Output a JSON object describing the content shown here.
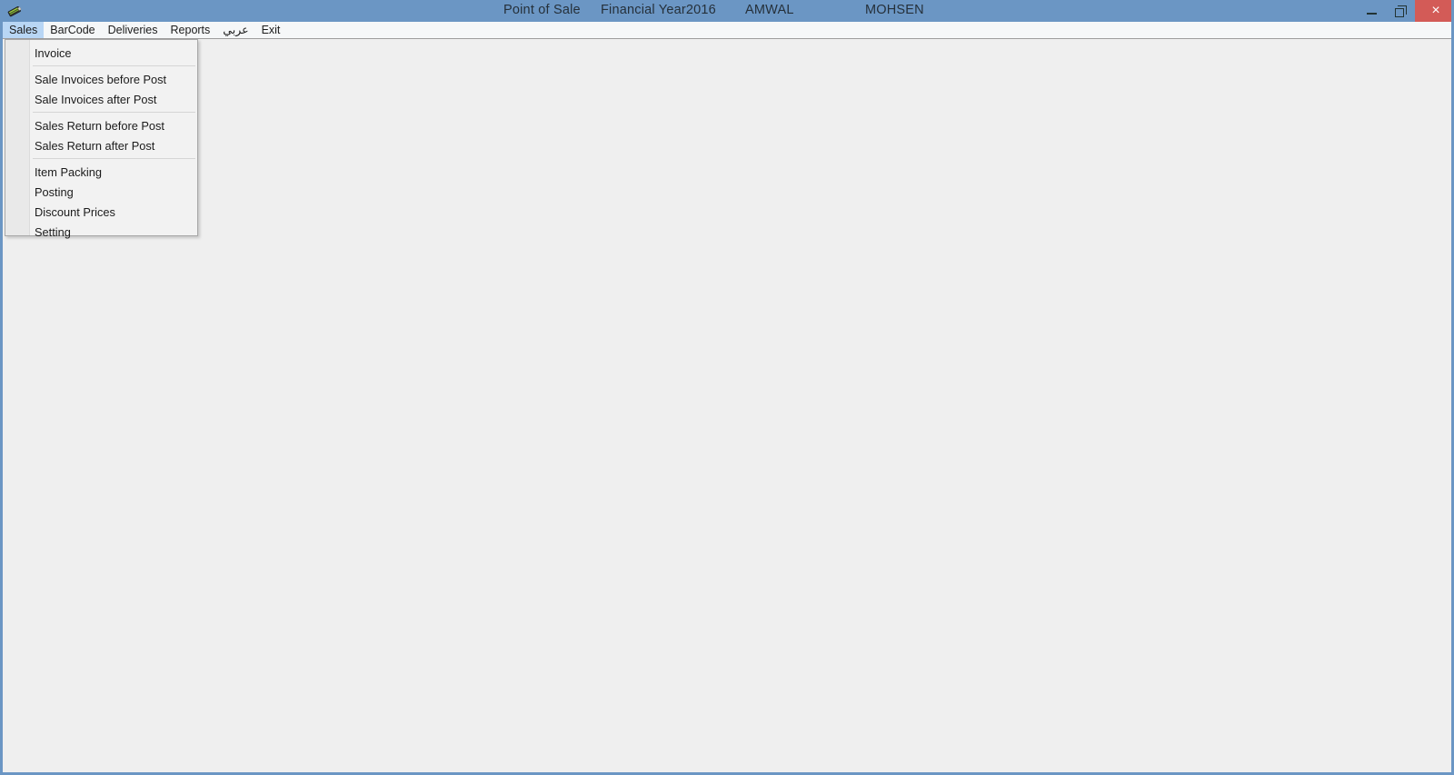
{
  "window": {
    "app_icon": "app-icon",
    "title_segments": [
      {
        "key": "point_of_sale",
        "label": "Point of Sale"
      },
      {
        "key": "financial_year",
        "label": "Financial Year2016"
      },
      {
        "key": "company",
        "label": "AMWAL"
      },
      {
        "key": "user",
        "label": "MOHSEN"
      }
    ],
    "controls": {
      "minimize_label": "",
      "restore_label": "",
      "close_label": "×"
    },
    "colors": {
      "titlebar": "#6b96c4",
      "close_button": "#d35b57",
      "menubar": "#f5f7f8",
      "menu_active": "#b8d6f5",
      "client_background": "#efefef",
      "dropdown_background": "#f2f2f2",
      "dropdown_border": "#a8a8a8"
    }
  },
  "menubar": {
    "items": [
      {
        "key": "sales",
        "label": "Sales",
        "active": true,
        "rtl": false
      },
      {
        "key": "barcode",
        "label": "BarCode",
        "active": false,
        "rtl": false
      },
      {
        "key": "deliveries",
        "label": "Deliveries",
        "active": false,
        "rtl": false
      },
      {
        "key": "reports",
        "label": "Reports",
        "active": false,
        "rtl": false
      },
      {
        "key": "arabic",
        "label": "عربي",
        "active": false,
        "rtl": true
      },
      {
        "key": "exit",
        "label": "Exit",
        "active": false,
        "rtl": false
      }
    ]
  },
  "sales_menu": {
    "open": true,
    "entries": [
      {
        "type": "item",
        "key": "invoice",
        "label": "Invoice"
      },
      {
        "type": "separator",
        "key": "sep-1",
        "label": ""
      },
      {
        "type": "item",
        "key": "sale-invoices-before-post",
        "label": "Sale Invoices before Post"
      },
      {
        "type": "item",
        "key": "sale-invoices-after-post",
        "label": "Sale Invoices after Post"
      },
      {
        "type": "separator",
        "key": "sep-2",
        "label": ""
      },
      {
        "type": "item",
        "key": "sales-return-before-post",
        "label": "Sales Return before Post"
      },
      {
        "type": "item",
        "key": "sales-return-after-post",
        "label": "Sales Return after Post"
      },
      {
        "type": "separator",
        "key": "sep-3",
        "label": ""
      },
      {
        "type": "item",
        "key": "item-packing",
        "label": "Item Packing"
      },
      {
        "type": "item",
        "key": "posting",
        "label": "Posting"
      },
      {
        "type": "item",
        "key": "discount-prices",
        "label": "Discount Prices"
      },
      {
        "type": "item",
        "key": "setting",
        "label": "Setting"
      }
    ]
  },
  "client": {
    "content": ""
  }
}
